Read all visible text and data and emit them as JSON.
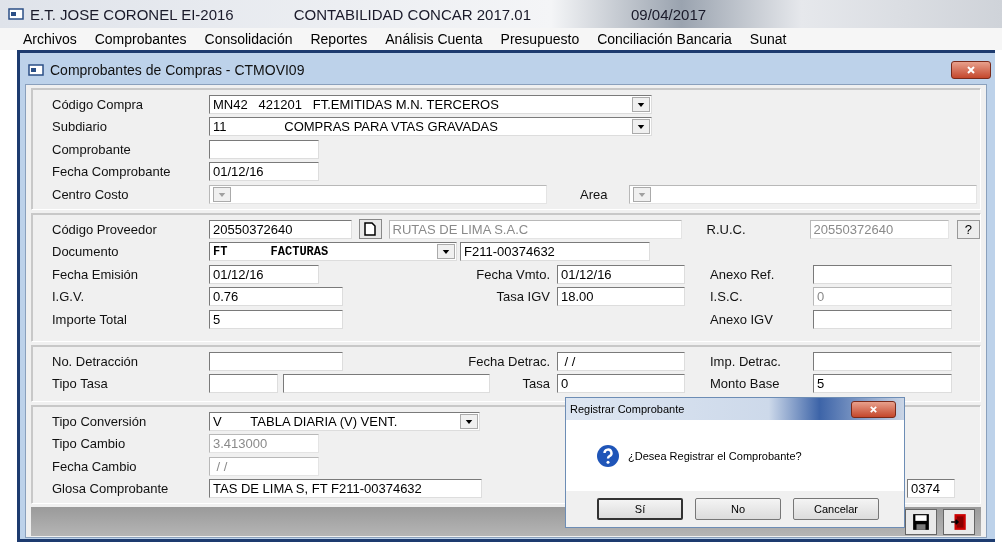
{
  "app_title_bar": {
    "company": "E.T. JOSE CORONEL EI-2016",
    "product": "CONTABILIDAD CONCAR 2017.01",
    "date": "09/04/2017"
  },
  "menu": [
    "Archivos",
    "Comprobantes",
    "Consolidación",
    "Reportes",
    "Análisis Cuenta",
    "Presupuesto",
    "Conciliación Bancaria",
    "Sunat"
  ],
  "window": {
    "title": "Comprobantes de Compras - CTMOVI09"
  },
  "header": {
    "codigo_compra": {
      "label": "Código Compra",
      "value": "MN42   421201   FT.EMITIDAS M.N. TERCEROS",
      "disabled": false
    },
    "subdiario": {
      "label": "Subdiario",
      "value": "11                COMPRAS PARA VTAS GRAVADAS",
      "disabled": false
    },
    "comprobante": {
      "label": "Comprobante",
      "disabled": false
    },
    "fecha_comprobante": {
      "label": "Fecha Comprobante",
      "value": "01/12/16",
      "disabled": false
    },
    "centro_costo": {
      "label": "Centro Costo",
      "disabled": true
    },
    "area": {
      "label": "Area",
      "disabled": true
    }
  },
  "proveedor": {
    "codigo_proveedor": {
      "label": "Código Proveedor",
      "value": "20550372640",
      "disabled": false
    },
    "razon_social": {
      "value": "RUTAS DE LIMA S.A.C",
      "disabled": true
    },
    "ruc": {
      "label": "R.U.C.",
      "value": "20550372640",
      "disabled": true
    },
    "help_button": "?",
    "documento": {
      "label": "Documento",
      "value": "FT      FACTURAS",
      "disabled": false
    },
    "numero_documento": {
      "value": "F211-00374632",
      "disabled": false
    },
    "fecha_emision": {
      "label": "Fecha Emisión",
      "value": "01/12/16",
      "disabled": false
    },
    "fecha_vmto": {
      "label": "Fecha Vmto.",
      "value": "01/12/16",
      "disabled": false
    },
    "anexo_ref": {
      "label": "Anexo Ref.",
      "disabled": false
    },
    "igv": {
      "label": "I.G.V.",
      "value": "0.76",
      "disabled": false
    },
    "tasa_igv": {
      "label": "Tasa IGV",
      "value": "18.00",
      "disabled": false
    },
    "isc": {
      "label": "I.S.C.",
      "value": "0",
      "disabled": true
    },
    "importe_total": {
      "label": "Importe Total",
      "value": "5",
      "disabled": false
    },
    "anexo_igv": {
      "label": "Anexo IGV",
      "disabled": false
    }
  },
  "detraccion": {
    "no_detraccion": {
      "label": "No. Detracción",
      "disabled": false
    },
    "fecha_detrac": {
      "label": "Fecha Detrac.",
      "value": " / /",
      "disabled": false
    },
    "imp_detrac": {
      "label": "Imp. Detrac.",
      "disabled": false
    },
    "tipo_tasa": {
      "label": "Tipo Tasa",
      "disabled": false
    },
    "tipo_tasa_descripcion": {
      "disabled": false
    },
    "tasa": {
      "label": "Tasa",
      "value": "0",
      "disabled": false
    },
    "monto_base": {
      "label": "Monto Base",
      "value": "5",
      "disabled": false
    }
  },
  "conversion": {
    "tipo_conversion": {
      "label": "Tipo Conversión",
      "value": "V        TABLA DIARIA (V) VENT.",
      "disabled": false
    },
    "tipo_cambio": {
      "label": "Tipo Cambio",
      "value": "3.413000",
      "disabled": true
    },
    "fecha_cambio": {
      "label": "Fecha Cambio",
      "value": " / /",
      "disabled": true
    },
    "glosa": {
      "label": "Glosa Comprobante",
      "value": "TAS DE LIMA S, FT F211-00374632",
      "disabled": false
    },
    "column_partial": {
      "value": "0374",
      "disabled": false
    }
  },
  "dialog": {
    "title": "Registrar Comprobante",
    "message": "¿Desea Registrar el Comprobante?",
    "buttons": [
      {
        "label": "Sí",
        "default": true
      },
      {
        "label": "No",
        "default": false
      },
      {
        "label": "Cancelar",
        "default": false
      }
    ]
  }
}
